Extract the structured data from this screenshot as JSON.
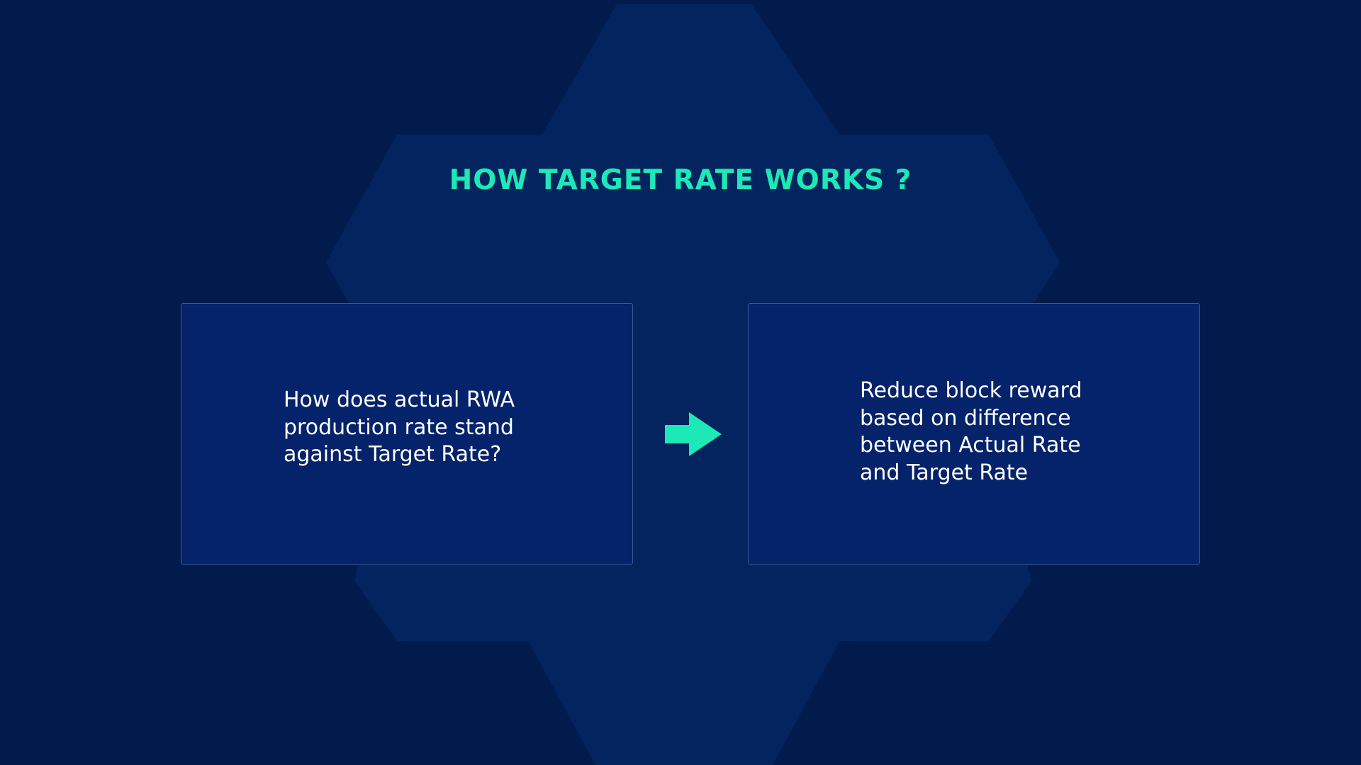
{
  "title": "HOW TARGET RATE WORKS ?",
  "colors": {
    "background": "#021b4d",
    "accent": "#1de9b6",
    "card_fill": "#05236a",
    "card_border": "#3b578f",
    "text": "#ffffff"
  },
  "steps": [
    {
      "text": "How does actual RWA\nproduction rate stand\nagainst Target Rate?"
    },
    {
      "text": "Reduce block reward\nbased on difference\nbetween Actual Rate\nand Target Rate"
    }
  ],
  "connector_icon": "arrow-right-icon"
}
